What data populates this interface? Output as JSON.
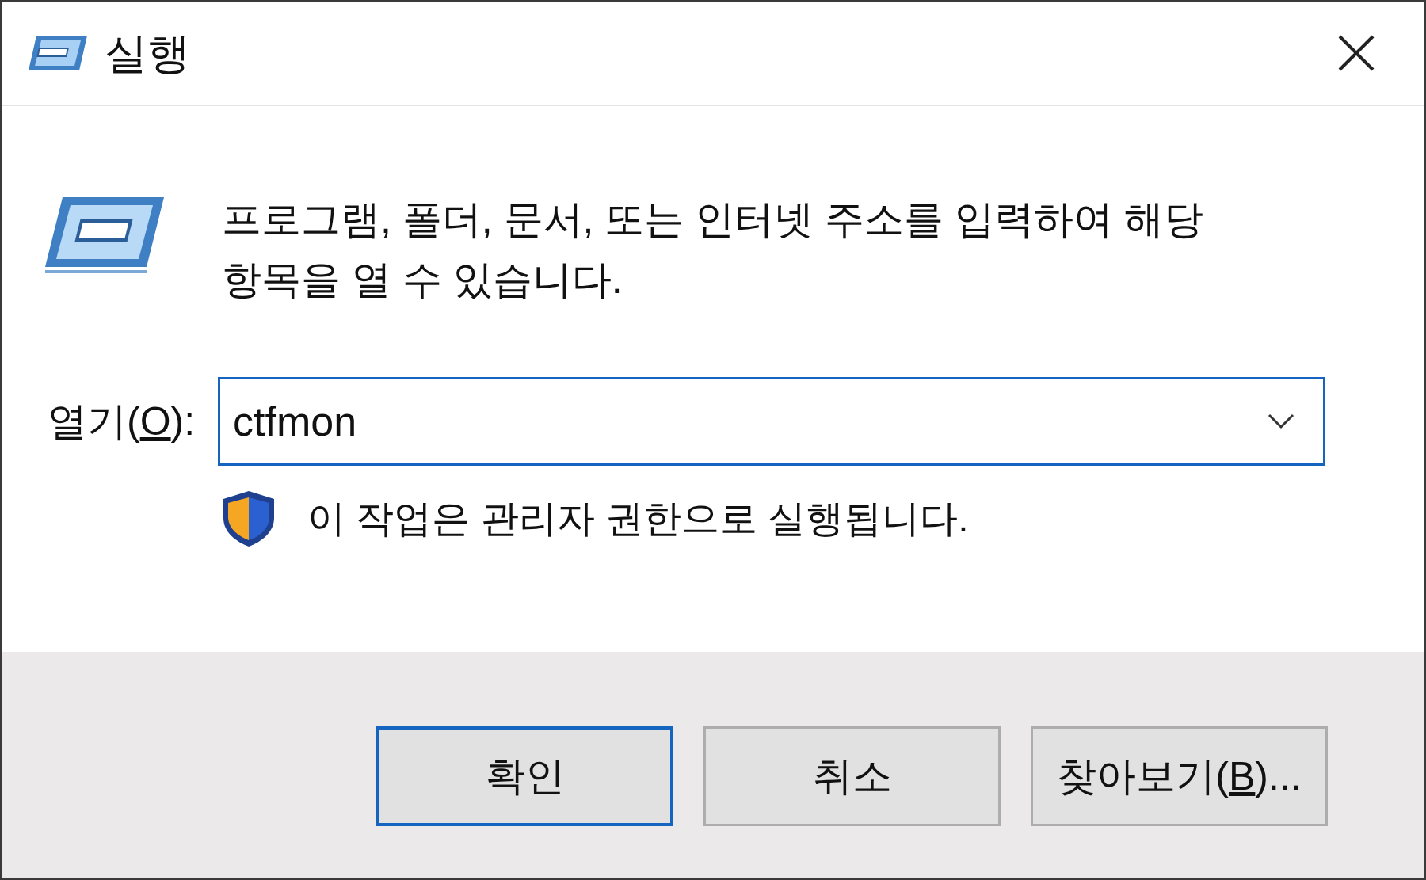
{
  "window": {
    "title": "실행"
  },
  "description": "프로그램, 폴더, 문서, 또는 인터넷 주소를 입력하여 해당\n항목을 열 수 있습니다.",
  "open_field": {
    "label_parts": [
      {
        "t": "열기("
      },
      {
        "t": "O",
        "underline": true
      },
      {
        "t": "):"
      }
    ],
    "value": "ctfmon",
    "focused": true
  },
  "admin_note": "이 작업은 관리자 권한으로 실행됩니다.",
  "buttons": [
    {
      "label_parts": [
        {
          "t": "확인"
        }
      ],
      "default": true
    },
    {
      "label_parts": [
        {
          "t": "취소"
        }
      ],
      "default": false
    },
    {
      "label_parts": [
        {
          "t": "찾아보기("
        },
        {
          "t": "B",
          "underline": true
        },
        {
          "t": ")..."
        }
      ],
      "default": false
    }
  ]
}
